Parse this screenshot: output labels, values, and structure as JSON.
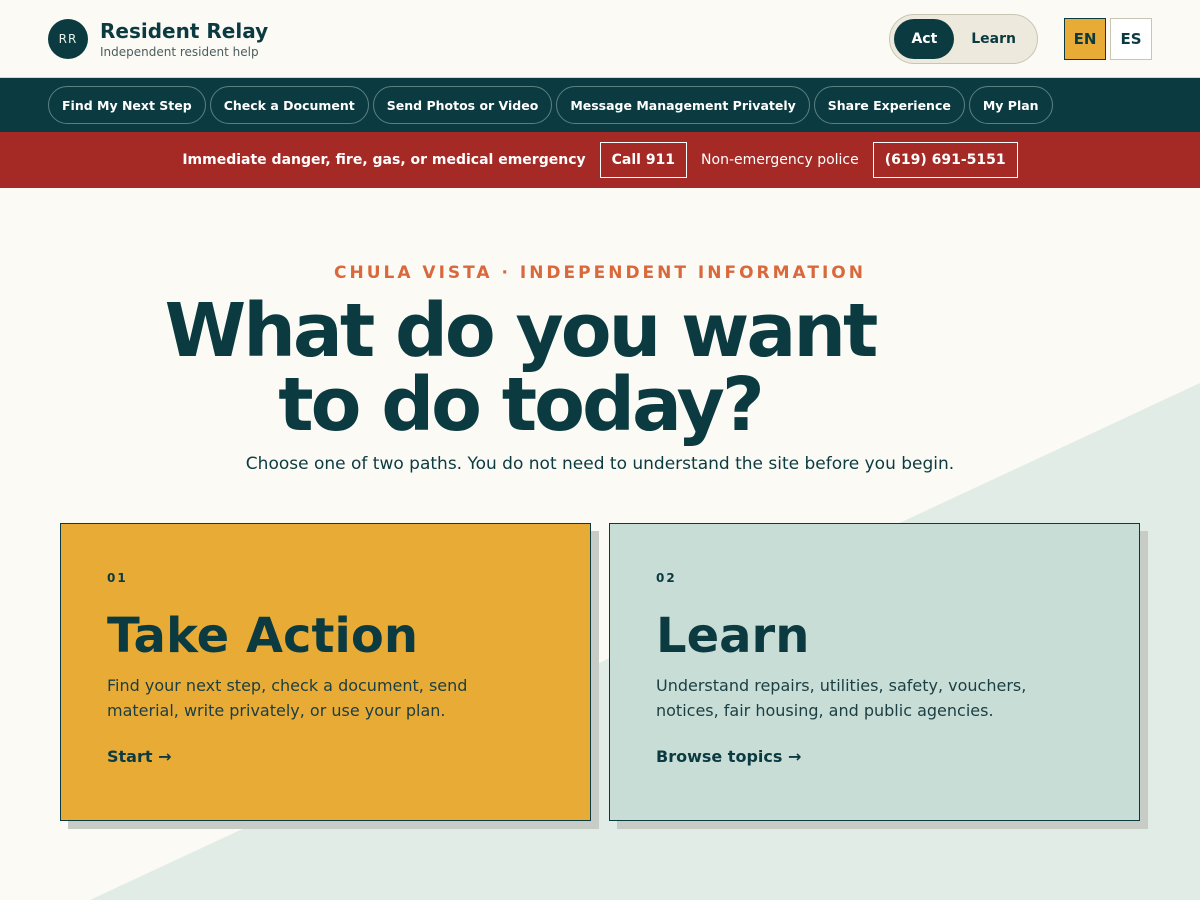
{
  "header": {
    "avatar_initials": "RR",
    "brand_name": "Resident Relay",
    "brand_sub": "Independent resident help",
    "mode_toggle": [
      {
        "label": "Act",
        "active": true
      },
      {
        "label": "Learn",
        "active": false
      }
    ],
    "languages": [
      {
        "label": "EN",
        "active": true
      },
      {
        "label": "ES",
        "active": false
      }
    ]
  },
  "nav": {
    "items": [
      {
        "label": "Find My Next Step"
      },
      {
        "label": "Check a Document"
      },
      {
        "label": "Send Photos or Video"
      },
      {
        "label": "Message Management Privately"
      },
      {
        "label": "Share Experience"
      },
      {
        "label": "My Plan"
      }
    ]
  },
  "emergency": {
    "title": "Immediate danger, fire, gas, or medical emergency",
    "call_button": "Call 911",
    "police_label": "Non-emergency police",
    "police_number": "(619) 691-5151"
  },
  "hero": {
    "eyebrow": "CHULA VISTA · INDEPENDENT INFORMATION",
    "headline": "What do you want to do today?",
    "subline": "Choose one of two paths. You do not need to understand the site before you begin."
  },
  "cards": [
    {
      "number": "01",
      "title": "Take Action",
      "description": "Find your next step, check a document, send material, write privately, or use your plan.",
      "link": "Start →"
    },
    {
      "number": "02",
      "title": "Learn",
      "description": "Understand repairs, utilities, safety, vouchers, notices, fair housing, and public agencies.",
      "link": "Browse topics →"
    }
  ],
  "colors": {
    "primary": "#0b3b40",
    "accent_gold": "#e8ab36",
    "emergency_red": "#a52a25",
    "eyebrow_orange": "#d9683c",
    "learn_card": "#c9ddd7"
  }
}
